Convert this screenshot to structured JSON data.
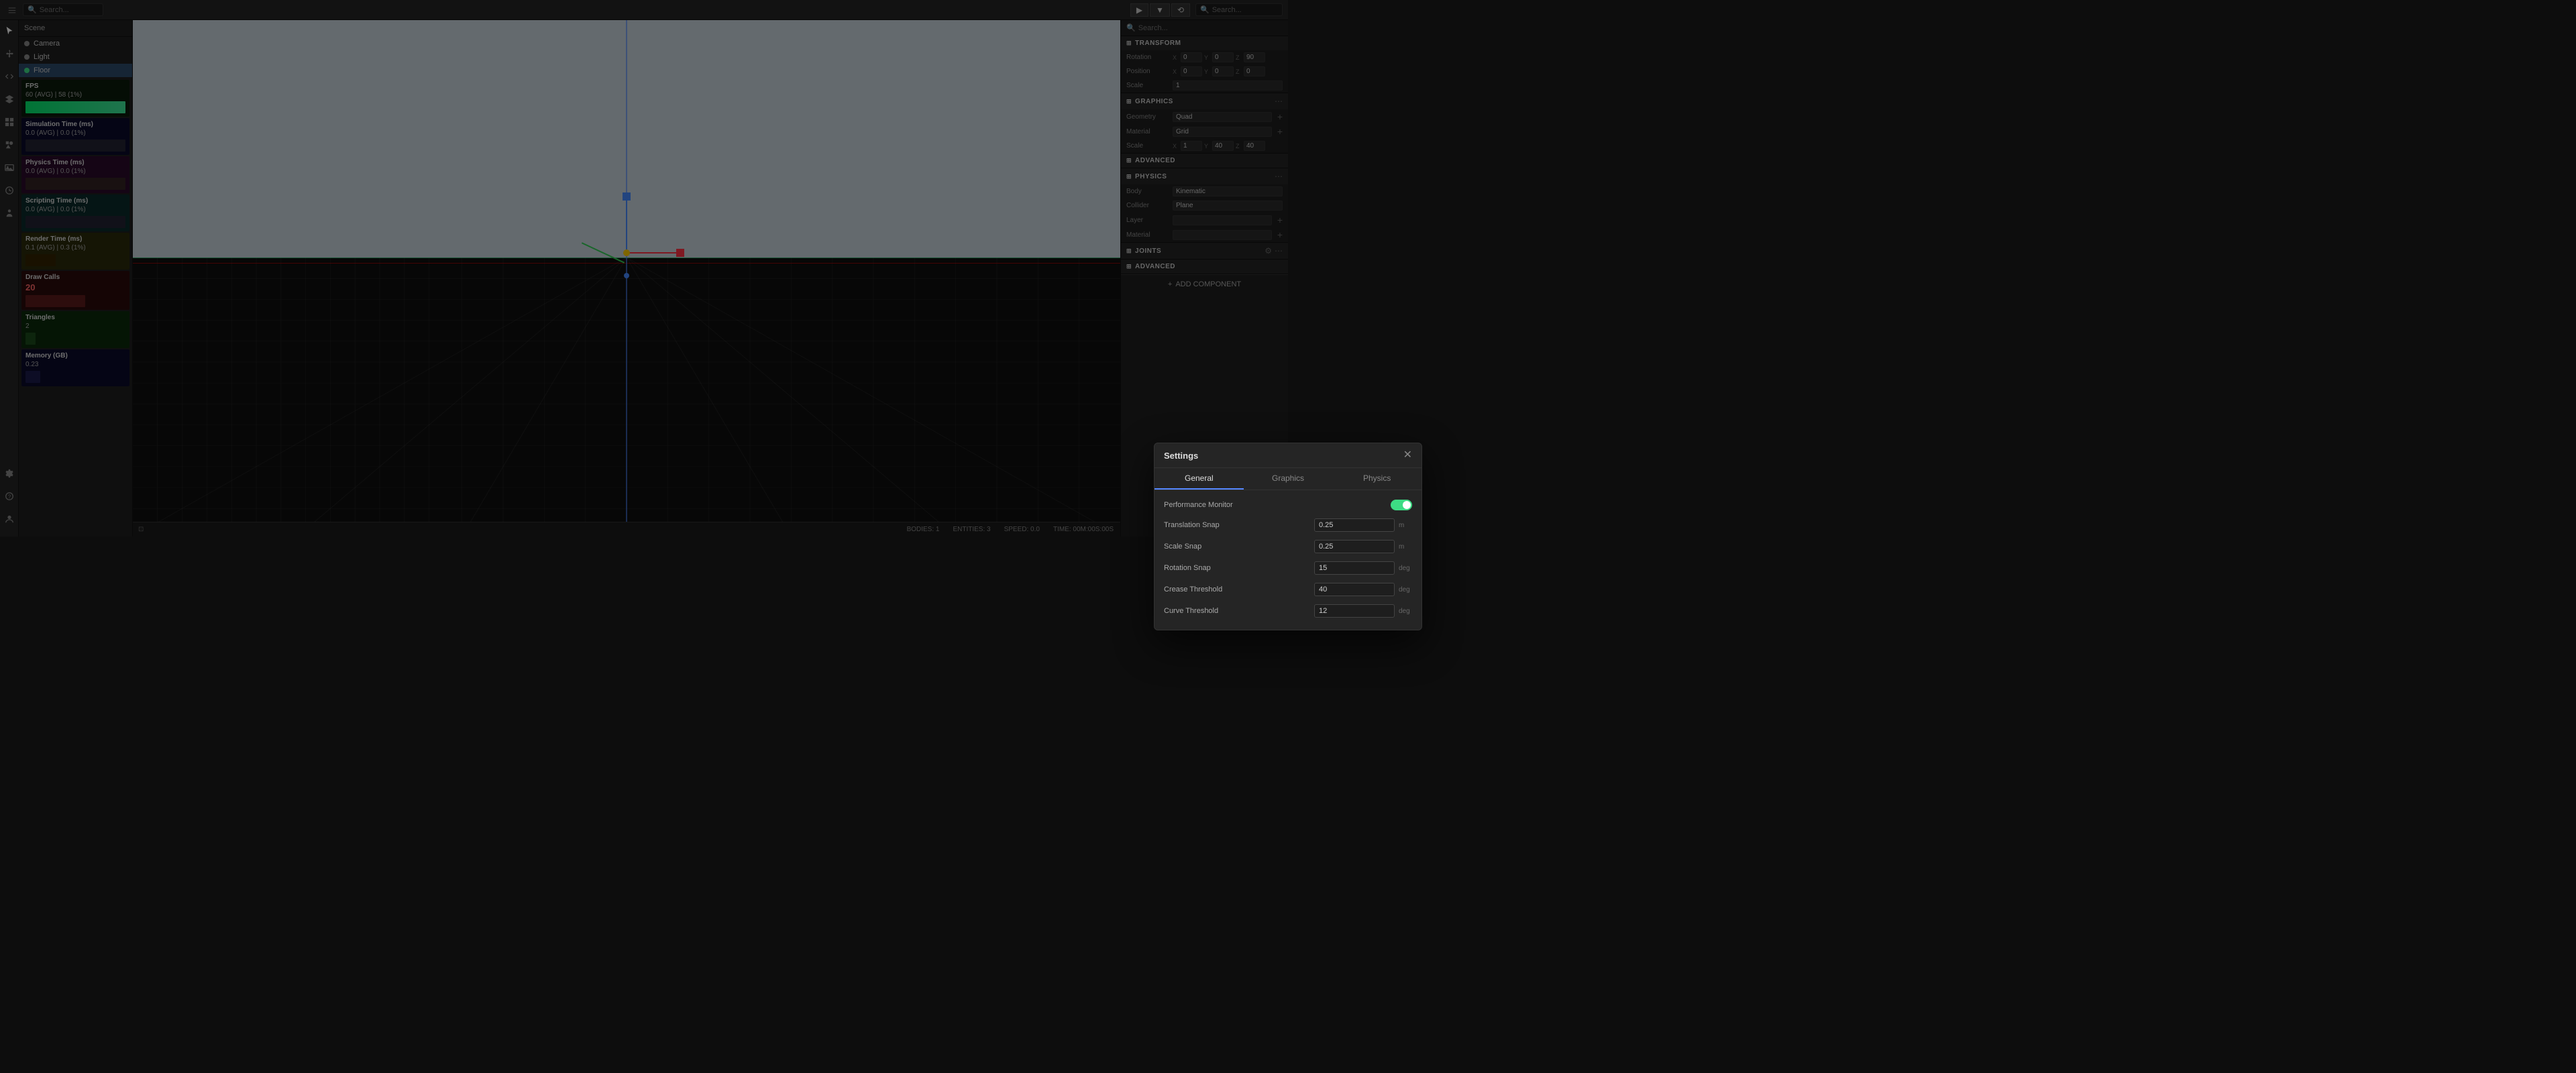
{
  "topbar": {
    "search_placeholder": "Search...",
    "search_placeholder_right": "Search..."
  },
  "scene": {
    "items": [
      {
        "label": "Camera",
        "type": "camera",
        "icon": "○"
      },
      {
        "label": "Light",
        "type": "light",
        "icon": "○"
      },
      {
        "label": "Floor",
        "type": "floor",
        "icon": "●",
        "selected": true
      }
    ]
  },
  "stats": [
    {
      "id": "fps",
      "title": "FPS",
      "value": "60 (AVG) | 58 (1%)",
      "color": "#1a3a1a"
    },
    {
      "id": "simulation",
      "title": "Simulation Time (ms)",
      "value": "0.0 (AVG) | 0.0 (1%)",
      "color": "#1a1a3a"
    },
    {
      "id": "physics",
      "title": "Physics Time (ms)",
      "value": "0.0 (AVG) | 0.0 (1%)",
      "color": "#3a1a3a"
    },
    {
      "id": "scripting",
      "title": "Scripting Time (ms)",
      "value": "0.0 (AVG) | 0.0 (1%)",
      "color": "#1a3a3a"
    },
    {
      "id": "render",
      "title": "Render Time (ms)",
      "value": "0.1 (AVG) | 0.3 (1%)",
      "color": "#3a3a1a"
    },
    {
      "id": "draws",
      "title": "Draw Calls",
      "value": "20",
      "color": "#3a1a1a"
    },
    {
      "id": "triangles",
      "title": "Triangles",
      "value": "2",
      "color": "#1a3a1a"
    },
    {
      "id": "memory",
      "title": "Memory (GB)",
      "value": "0.23",
      "color": "#1a1a3a"
    }
  ],
  "modal": {
    "title": "Settings",
    "tabs": [
      {
        "label": "General",
        "active": true
      },
      {
        "label": "Graphics",
        "active": false
      },
      {
        "label": "Physics",
        "active": false
      }
    ],
    "settings": [
      {
        "label": "Performance Monitor",
        "type": "toggle",
        "value": "on"
      },
      {
        "label": "Translation Snap",
        "value": "0.25",
        "unit": "m"
      },
      {
        "label": "Scale Snap",
        "value": "0.25",
        "unit": "m"
      },
      {
        "label": "Rotation Snap",
        "value": "15",
        "unit": "deg"
      },
      {
        "label": "Crease Threshold",
        "value": "40",
        "unit": "deg"
      },
      {
        "label": "Curve Threshold",
        "value": "12",
        "unit": "deg"
      }
    ]
  },
  "right_panel": {
    "search_placeholder": "Search...",
    "sections": {
      "transform": {
        "title": "TRANSFORM",
        "rotation": {
          "x": "0",
          "y": "0",
          "z": "90"
        },
        "position": {
          "x": "0",
          "y": "0",
          "z": "0"
        },
        "scale": "1"
      },
      "graphics": {
        "title": "GRAPHICS",
        "geometry": "Quad",
        "material": "Grid",
        "scale": {
          "x": "1",
          "y": "40",
          "z": "40"
        }
      },
      "advanced_1": {
        "title": "ADVANCED"
      },
      "physics": {
        "title": "PHYSICS",
        "body": "Kinematic",
        "collider": "Plane",
        "layer": "",
        "material": ""
      },
      "joints": {
        "title": "JOINTS"
      },
      "advanced_2": {
        "title": "ADVANCED"
      }
    },
    "add_component": "ADD COMPONENT"
  },
  "statusbar": {
    "bodies": "BODIES: 1",
    "entities": "ENTITIES: 3",
    "speed": "SPEED: 0.0",
    "time": "TIME: 00M:00S:00S"
  }
}
